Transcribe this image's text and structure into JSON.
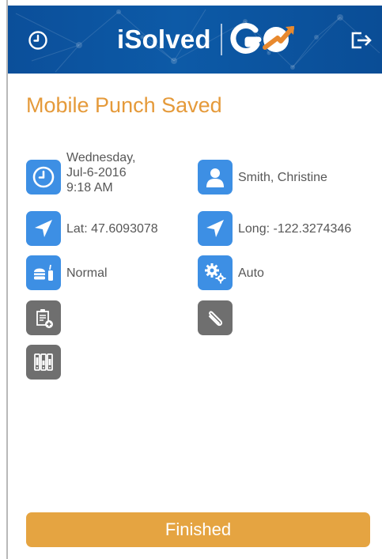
{
  "header": {
    "brand_text": "iSolved",
    "brand_go": "GO",
    "color": "#0d56a2",
    "history_icon": "clock-icon",
    "logout_icon": "logout-icon"
  },
  "page_title": "Mobile Punch Saved",
  "details": {
    "date_lines": [
      "Wednesday,",
      "Jul-6-2016",
      "9:18 AM"
    ],
    "employee": "Smith, Christine",
    "latitude": "Lat: 47.6093078",
    "longitude": "Long: -122.3274346",
    "punch_type": "Normal",
    "mode": "Auto"
  },
  "icons": {
    "date": "clock-icon",
    "employee": "person-icon",
    "latitude": "location-arrow-icon",
    "longitude": "location-arrow-icon",
    "punch_type": "meal-break-icon",
    "mode": "gears-icon",
    "note": "add-note-icon",
    "attachment": "paperclip-icon",
    "labor": "labor-allocation-icon"
  },
  "colors": {
    "accent": "#e59a3a",
    "button": "#e5a441",
    "blue_icon": "#3d8fe4",
    "gray_icon": "#6f6f6f"
  },
  "buttons": {
    "finished": "Finished"
  }
}
